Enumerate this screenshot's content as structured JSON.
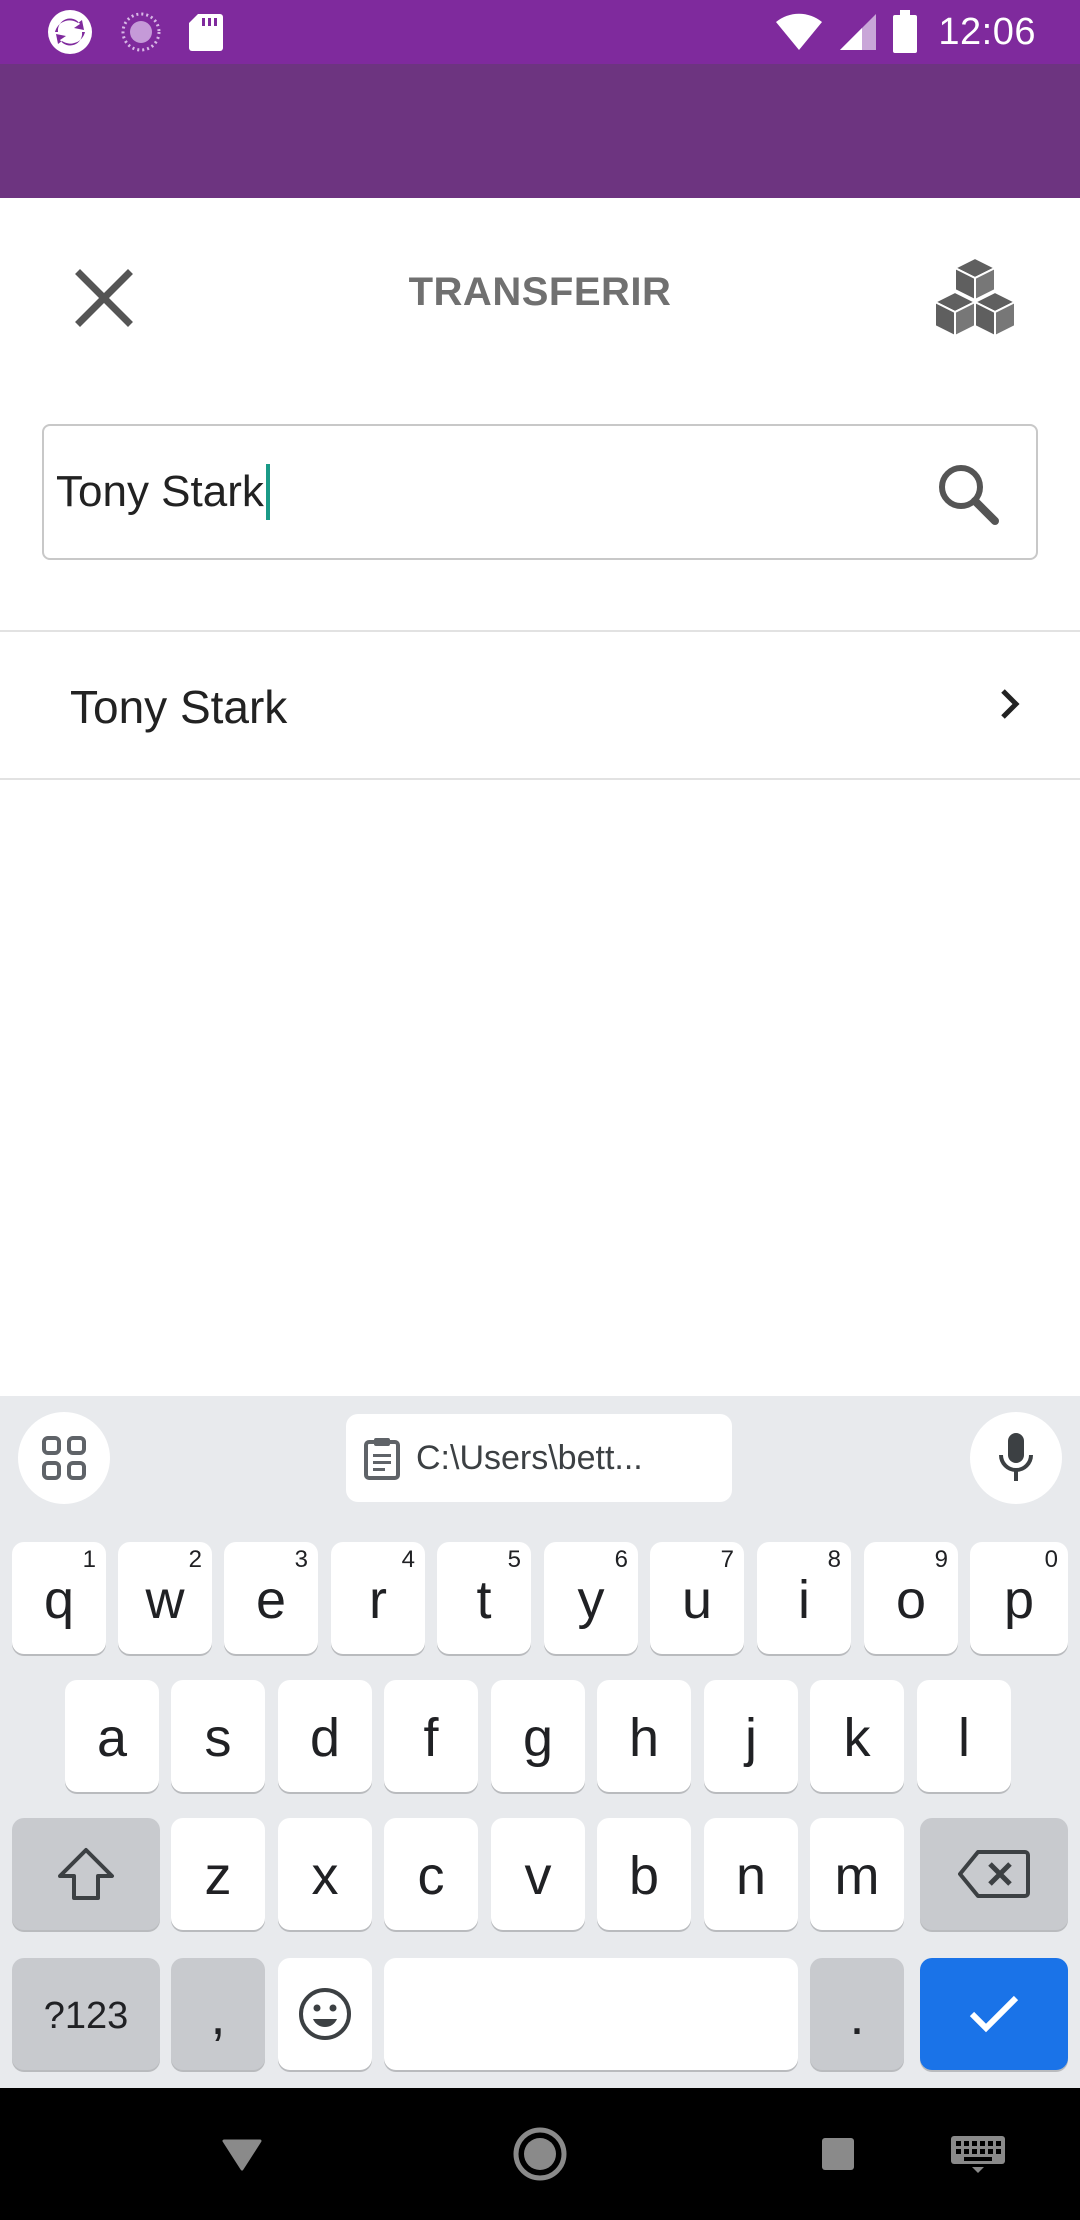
{
  "status_bar": {
    "time": "12:06",
    "left_icons": [
      "app-logo-icon",
      "loading-circle-icon",
      "sd-card-icon"
    ],
    "right_icons": [
      "wifi-icon",
      "cellular-signal-icon",
      "battery-icon"
    ]
  },
  "colors": {
    "status_bar": "#7f2a9d",
    "app_bar": "#6d3480",
    "title": "#707070",
    "caret": "#1a9a87",
    "keyboard_bg": "#e8eaed",
    "action_key": "#1a73e8"
  },
  "sheet": {
    "title": "TRANSFERIR",
    "close_icon": "close-icon",
    "action_icon": "cubes-icon"
  },
  "search": {
    "value": "Tony Stark",
    "icon": "search-icon"
  },
  "results": [
    {
      "name": "Tony Stark",
      "icon": "chevron-right-icon"
    }
  ],
  "keyboard": {
    "clipboard_text": "C:\\Users\\bett...",
    "row1": [
      {
        "key": "q",
        "hint": "1"
      },
      {
        "key": "w",
        "hint": "2"
      },
      {
        "key": "e",
        "hint": "3"
      },
      {
        "key": "r",
        "hint": "4"
      },
      {
        "key": "t",
        "hint": "5"
      },
      {
        "key": "y",
        "hint": "6"
      },
      {
        "key": "u",
        "hint": "7"
      },
      {
        "key": "i",
        "hint": "8"
      },
      {
        "key": "o",
        "hint": "9"
      },
      {
        "key": "p",
        "hint": "0"
      }
    ],
    "row2": [
      "a",
      "s",
      "d",
      "f",
      "g",
      "h",
      "j",
      "k",
      "l"
    ],
    "row3": [
      "z",
      "x",
      "c",
      "v",
      "b",
      "n",
      "m"
    ],
    "row4": {
      "symbols": "?123",
      "comma": ",",
      "period": "."
    }
  },
  "nav_bar": {
    "icons": [
      "back-triangle-icon",
      "home-circle-icon",
      "recents-square-icon",
      "keyboard-switch-icon"
    ]
  }
}
